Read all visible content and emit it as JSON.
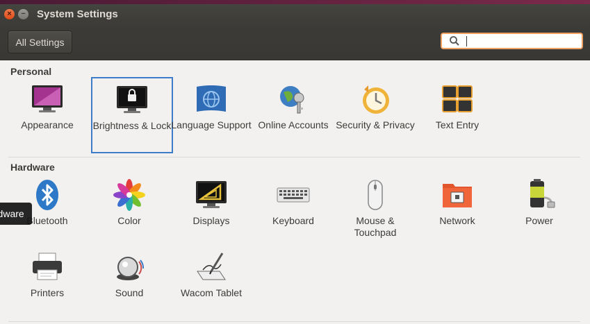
{
  "window": {
    "title": "System Settings",
    "close_glyph": "×",
    "min_glyph": "−"
  },
  "toolbar": {
    "all_settings_label": "All Settings",
    "search_value": ""
  },
  "sections": {
    "personal": "Personal",
    "hardware": "Hardware"
  },
  "personal_items": [
    {
      "label": "Appearance",
      "icon": "appearance-icon"
    },
    {
      "label": "Brightness & Lock",
      "icon": "brightness-lock-icon",
      "selected": true
    },
    {
      "label": "Language Support",
      "icon": "language-icon"
    },
    {
      "label": "Online Accounts",
      "icon": "online-accounts-icon"
    },
    {
      "label": "Security & Privacy",
      "icon": "security-privacy-icon"
    },
    {
      "label": "Text Entry",
      "icon": "text-entry-icon"
    }
  ],
  "hardware_items": [
    {
      "label": "Bluetooth",
      "icon": "bluetooth-icon"
    },
    {
      "label": "Color",
      "icon": "color-icon"
    },
    {
      "label": "Displays",
      "icon": "displays-icon"
    },
    {
      "label": "Keyboard",
      "icon": "keyboard-icon"
    },
    {
      "label": "Mouse & Touchpad",
      "icon": "mouse-icon"
    },
    {
      "label": "Network",
      "icon": "network-icon"
    },
    {
      "label": "Power",
      "icon": "power-icon"
    },
    {
      "label": "Printers",
      "icon": "printer-icon"
    },
    {
      "label": "Sound",
      "icon": "sound-icon"
    },
    {
      "label": "Wacom Tablet",
      "icon": "wacom-tablet-icon"
    }
  ],
  "tooltip": {
    "text": "Hardware"
  },
  "colors": {
    "accent": "#3d7cc9",
    "titlebar": "#3c3b37",
    "close": "#df4a16",
    "search_border": "#f0a060"
  }
}
